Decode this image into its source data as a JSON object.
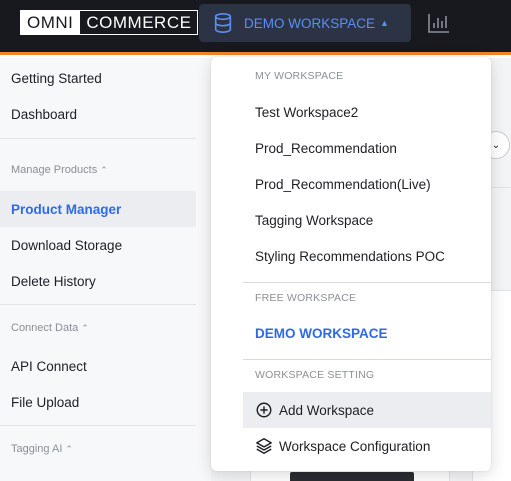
{
  "header": {
    "logo_left": "OMNI",
    "logo_right": "COMMERCE",
    "workspace_button_label": "DEMO WORKSPACE",
    "icons": [
      "database-icon",
      "caret-up-icon",
      "bar-chart-icon"
    ]
  },
  "sidebar": {
    "items_top": [
      {
        "label": "Getting Started"
      },
      {
        "label": "Dashboard"
      }
    ],
    "sections": [
      {
        "title": "Manage Products",
        "items": [
          {
            "label": "Product Manager",
            "active": true
          },
          {
            "label": "Download Storage"
          },
          {
            "label": "Delete History"
          }
        ]
      },
      {
        "title": "Connect Data",
        "items": [
          {
            "label": "API Connect"
          },
          {
            "label": "File Upload"
          }
        ]
      },
      {
        "title": "Tagging AI",
        "items": []
      }
    ]
  },
  "workspace_dropdown": {
    "my_workspace_title": "MY WORKSPACE",
    "my_workspaces": [
      "Test Workspace2",
      "Prod_Recommendation",
      "Prod_Recommendation(Live)",
      "Tagging Workspace",
      "Styling Recommendations POC"
    ],
    "free_workspace_title": "FREE WORKSPACE",
    "free_workspace": "DEMO WORKSPACE",
    "setting_title": "WORKSPACE SETTING",
    "settings": [
      {
        "label": "Add Workspace",
        "icon": "plus-circle-icon"
      },
      {
        "label": "Workspace Configuration",
        "icon": "layers-icon"
      }
    ]
  },
  "colors": {
    "topbar": "#17191e",
    "accent_orange": "#f0862a",
    "accent_blue": "#2f6ae6",
    "workspace_button_bg": "#2b3344"
  }
}
